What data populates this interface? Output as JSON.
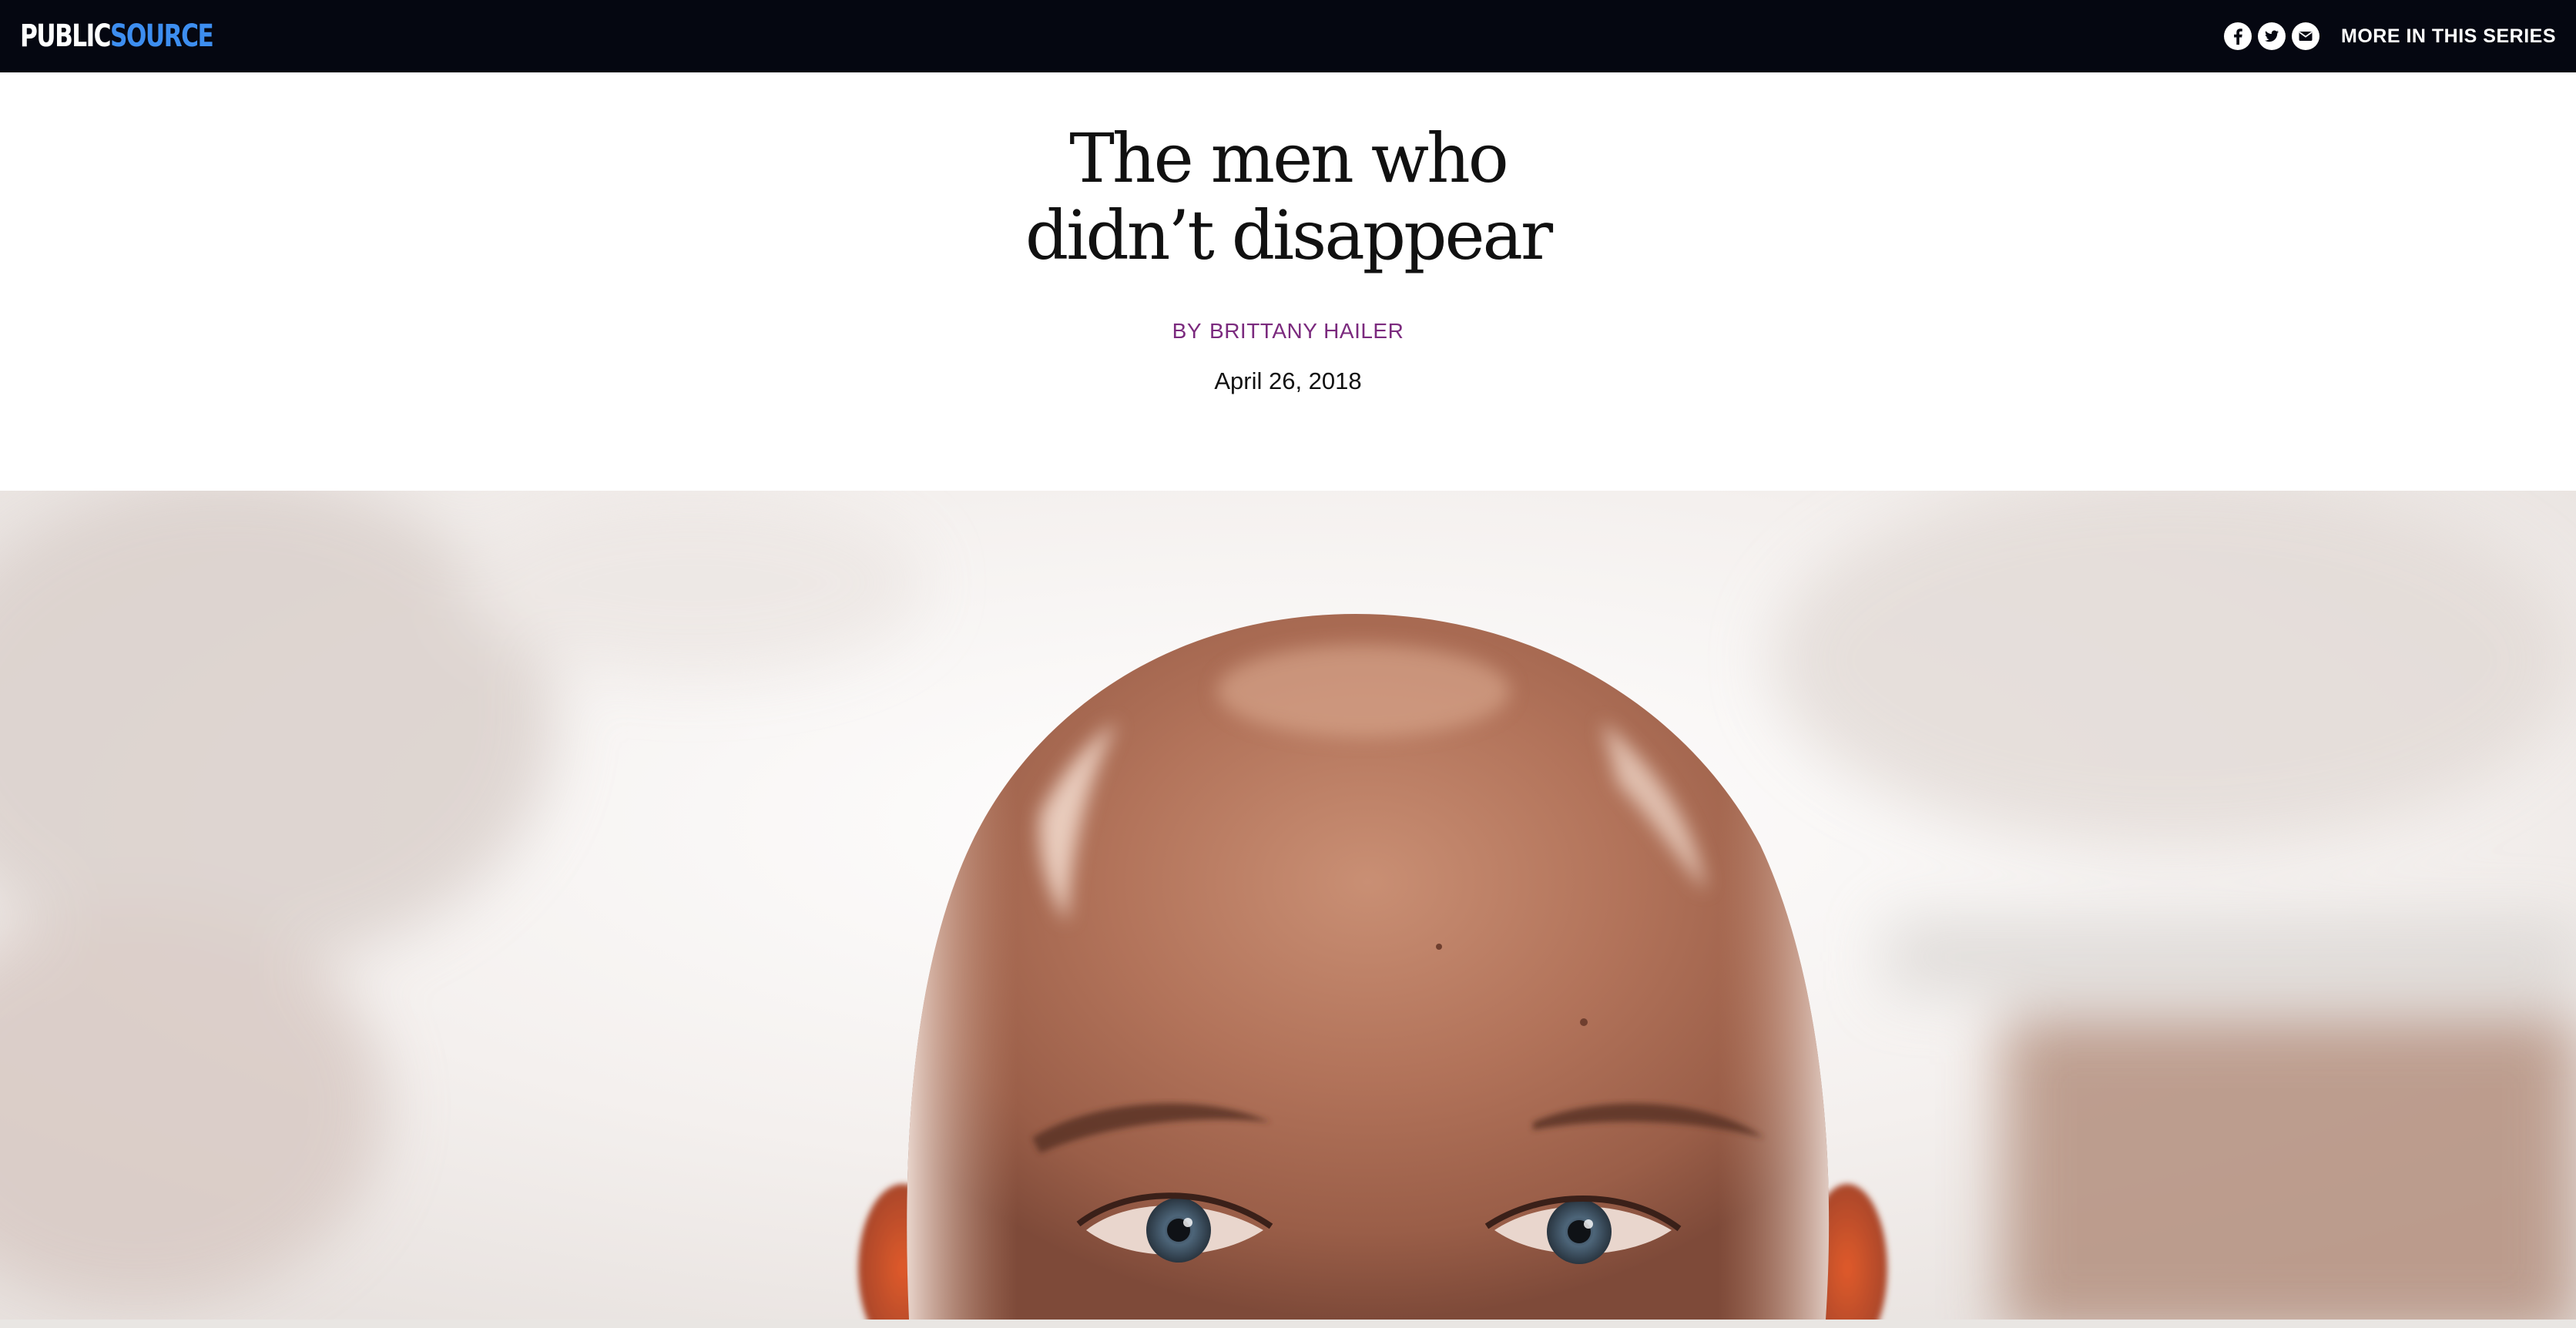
{
  "brand": {
    "part1": "PUBLIC",
    "part2": "SOURCE",
    "color_primary": "#ffffff",
    "color_accent": "#3d8ef0"
  },
  "nav": {
    "share_icons": [
      "facebook-icon",
      "twitter-icon",
      "email-icon"
    ],
    "series_link": "MORE IN THIS SERIES"
  },
  "article": {
    "title_line1": "The men who",
    "title_line2": "didn’t disappear",
    "byline_prefix": "BY",
    "author": "BRITTANY HAILER",
    "date": "April 26, 2018",
    "byline_color": "#7b2a7e"
  },
  "hero": {
    "description_icon": "hero-portrait-image"
  }
}
